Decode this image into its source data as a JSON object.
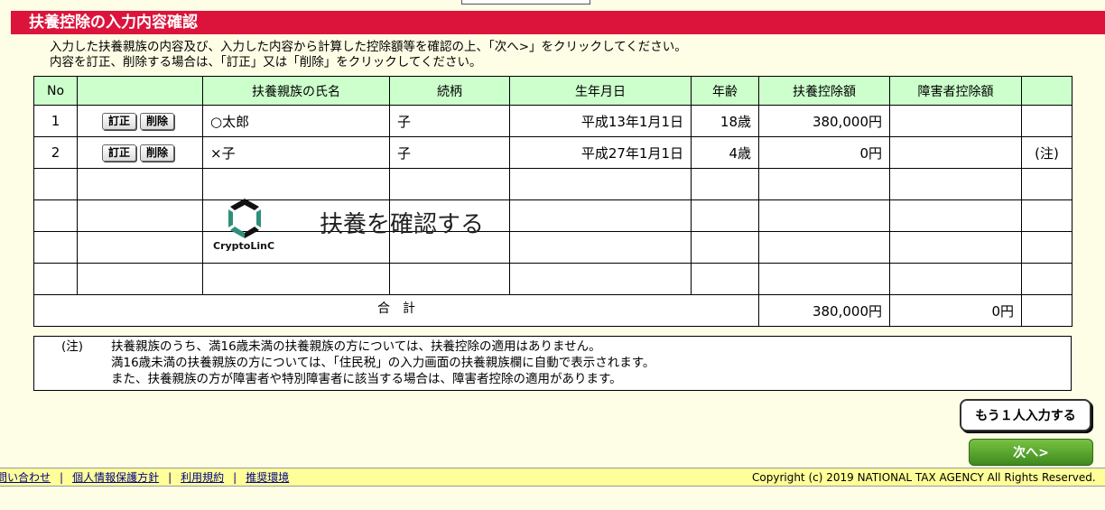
{
  "page": {
    "title": "扶養控除の入力内容確認",
    "intro_line1": "入力した扶養親族の内容及び、入力した内容から計算した控除額等を確認の上、「次へ>」をクリックしてください。",
    "intro_line2": "内容を訂正、削除する場合は、「訂正」又は「削除」をクリックしてください。"
  },
  "table": {
    "headers": [
      "No",
      "",
      "扶養親族の氏名",
      "続柄",
      "生年月日",
      "年齢",
      "扶養控除額",
      "障害者控除額",
      ""
    ],
    "edit_label": "訂正",
    "delete_label": "削除",
    "rows": [
      {
        "no": "1",
        "name": "○太郎",
        "relation": "子",
        "birth": "平成13年1月1日",
        "age": "18歳",
        "deduction": "380,000円",
        "disability": "",
        "note": ""
      },
      {
        "no": "2",
        "name": "×子",
        "relation": "子",
        "birth": "平成27年1月1日",
        "age": "4歳",
        "deduction": "0円",
        "disability": "",
        "note": "(注)"
      }
    ],
    "total_label": "合　計",
    "total_deduction": "380,000円",
    "total_disability": "0円"
  },
  "watermark": {
    "text": "扶養を確認する",
    "brand": "CryptoLinC"
  },
  "note": {
    "label": "(注)",
    "line1": "扶養親族のうち、満16歳未満の扶養親族の方については、扶養控除の適用はありません。",
    "line2": "満16歳未満の扶養親族の方については、「住民税」の入力画面の扶養親族欄に自動で表示されます。",
    "line3": "また、扶養親族の方が障害者や特別障害者に該当する場合は、障害者控除の適用があります。"
  },
  "buttons": {
    "add_another": "もう１人入力する",
    "next": "次へ>"
  },
  "footer": {
    "links": [
      "問い合わせ",
      "個人情報保護方針",
      "利用規約",
      "推奨環境"
    ],
    "copyright": "Copyright (c) 2019 NATIONAL TAX AGENCY All Rights Reserved."
  },
  "colors": {
    "title_bar": "#dc143c",
    "header_bg": "#ccffcc",
    "page_bg": "#fefee6",
    "footer_bg": "#ffff99",
    "next_button": "#4f9e2a"
  }
}
